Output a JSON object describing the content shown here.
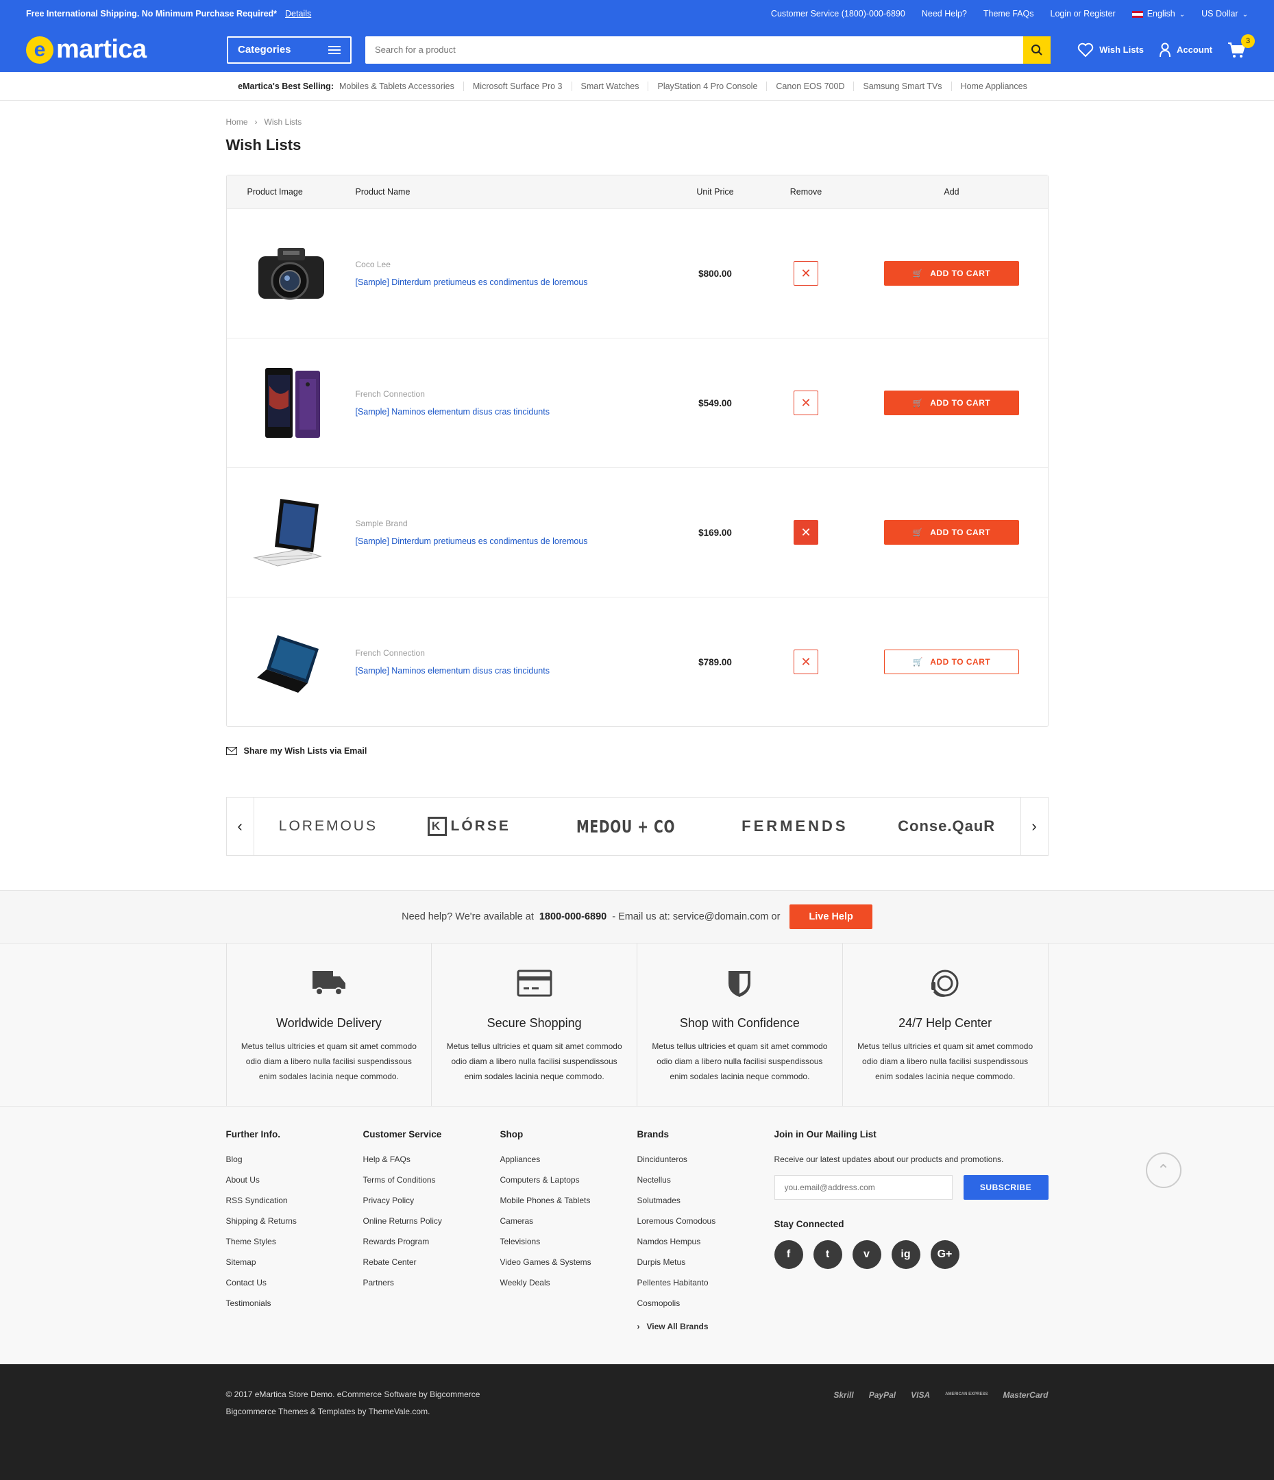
{
  "topbar": {
    "promo": "Free International Shipping. No Minimum Purchase Required*",
    "details": "Details",
    "customer_service": "Customer Service (1800)-000-6890",
    "need_help": "Need Help?",
    "theme_faqs": "Theme FAQs",
    "login": "Login or Register",
    "language": "English",
    "currency": "US Dollar"
  },
  "header": {
    "logo_e": "e",
    "logo_text": "martica",
    "categories": "Categories",
    "search_placeholder": "Search for a product",
    "wish_lists": "Wish Lists",
    "account": "Account",
    "cart_count": "3"
  },
  "best_selling": {
    "label": "eMartica's Best Selling:",
    "items": [
      "Mobiles & Tablets Accessories",
      "Microsoft Surface Pro 3",
      "Smart Watches",
      "PlayStation 4 Pro Console",
      "Canon EOS 700D",
      "Samsung Smart TVs",
      "Home Appliances"
    ]
  },
  "breadcrumb": {
    "home": "Home",
    "current": "Wish Lists"
  },
  "page_title": "Wish Lists",
  "table": {
    "headers": {
      "image": "Product Image",
      "name": "Product Name",
      "price": "Unit Price",
      "remove": "Remove",
      "add": "Add"
    },
    "rows": [
      {
        "brand": "Coco Lee",
        "name": "[Sample] Dinterdum pretiumeus es condimentus de loremous",
        "price": "$800.00",
        "image": "camera-image",
        "add_label": "ADD TO CART"
      },
      {
        "brand": "French Connection",
        "name": "[Sample] Naminos elementum disus cras tincidunts",
        "price": "$549.00",
        "image": "smartphone-image",
        "add_label": "ADD TO CART"
      },
      {
        "brand": "Sample Brand",
        "name": "[Sample] Dinterdum pretiumeus es condimentus de loremous",
        "price": "$169.00",
        "image": "tablet-keyboard-image",
        "add_label": "ADD TO CART"
      },
      {
        "brand": "French Connection",
        "name": "[Sample] Naminos elementum disus cras tincidunts",
        "price": "$789.00",
        "image": "laptop-image",
        "add_label": "ADD TO CART"
      }
    ]
  },
  "share": "Share my Wish Lists via Email",
  "brands": {
    "b1": "LOREMOUS",
    "b2_letter": "K",
    "b2": "LÓRSE",
    "b3": "MEDOU + CO",
    "b4": "FERMENDS",
    "b5": "Conse.QauR"
  },
  "help": {
    "prefix": "Need help? We're available at",
    "phone": "1800-000-6890",
    "email_text": "- Email us at: service@domain.com or",
    "live_help": "Live Help"
  },
  "features": [
    {
      "title": "Worldwide Delivery",
      "text": "Metus tellus ultricies et quam sit amet commodo odio diam a libero nulla facilisi suspendissous enim sodales lacinia neque commodo."
    },
    {
      "title": "Secure Shopping",
      "text": "Metus tellus ultricies et quam sit amet commodo odio diam a libero nulla facilisi suspendissous enim sodales lacinia neque commodo."
    },
    {
      "title": "Shop with Confidence",
      "text": "Metus tellus ultricies et quam sit amet commodo odio diam a libero nulla facilisi suspendissous enim sodales lacinia neque commodo."
    },
    {
      "title": "24/7 Help Center",
      "text": "Metus tellus ultricies et quam sit amet commodo odio diam a libero nulla facilisi suspendissous enim sodales lacinia neque commodo."
    }
  ],
  "footer": {
    "further": {
      "title": "Further Info.",
      "items": [
        "Blog",
        "About Us",
        "RSS Syndication",
        "Shipping & Returns",
        "Theme Styles",
        "Sitemap",
        "Contact Us",
        "Testimonials"
      ]
    },
    "service": {
      "title": "Customer Service",
      "items": [
        "Help & FAQs",
        "Terms of Conditions",
        "Privacy Policy",
        "Online Returns Policy",
        "Rewards Program",
        "Rebate Center",
        "Partners"
      ]
    },
    "shop": {
      "title": "Shop",
      "items": [
        "Appliances",
        "Computers & Laptops",
        "Mobile Phones & Tablets",
        "Cameras",
        "Televisions",
        "Video Games & Systems",
        "Weekly Deals"
      ]
    },
    "brands": {
      "title": "Brands",
      "items": [
        "Dincidunteros",
        "Nectellus",
        "Solutmades",
        "Loremous Comodous",
        "Namdos Hempus",
        "Durpis Metus",
        "Pellentes Habitanto",
        "Cosmopolis"
      ],
      "view_all": "View All Brands"
    },
    "mailing": {
      "title": "Join in Our Mailing List",
      "desc": "Receive our latest updates about our products and promotions.",
      "placeholder": "you.email@address.com",
      "subscribe": "SUBSCRIBE",
      "stay": "Stay Connected",
      "social": [
        "f",
        "t",
        "v",
        "ig",
        "G+"
      ]
    }
  },
  "bottom": {
    "copy1": "© 2017 eMartica Store Demo. eCommerce Software by Bigcommerce",
    "copy2": "Bigcommerce Themes & Templates by ThemeVale.com.",
    "payments": [
      "Skrill",
      "PayPal",
      "VISA",
      "AMERICAN EXPRESS",
      "MasterCard"
    ]
  }
}
